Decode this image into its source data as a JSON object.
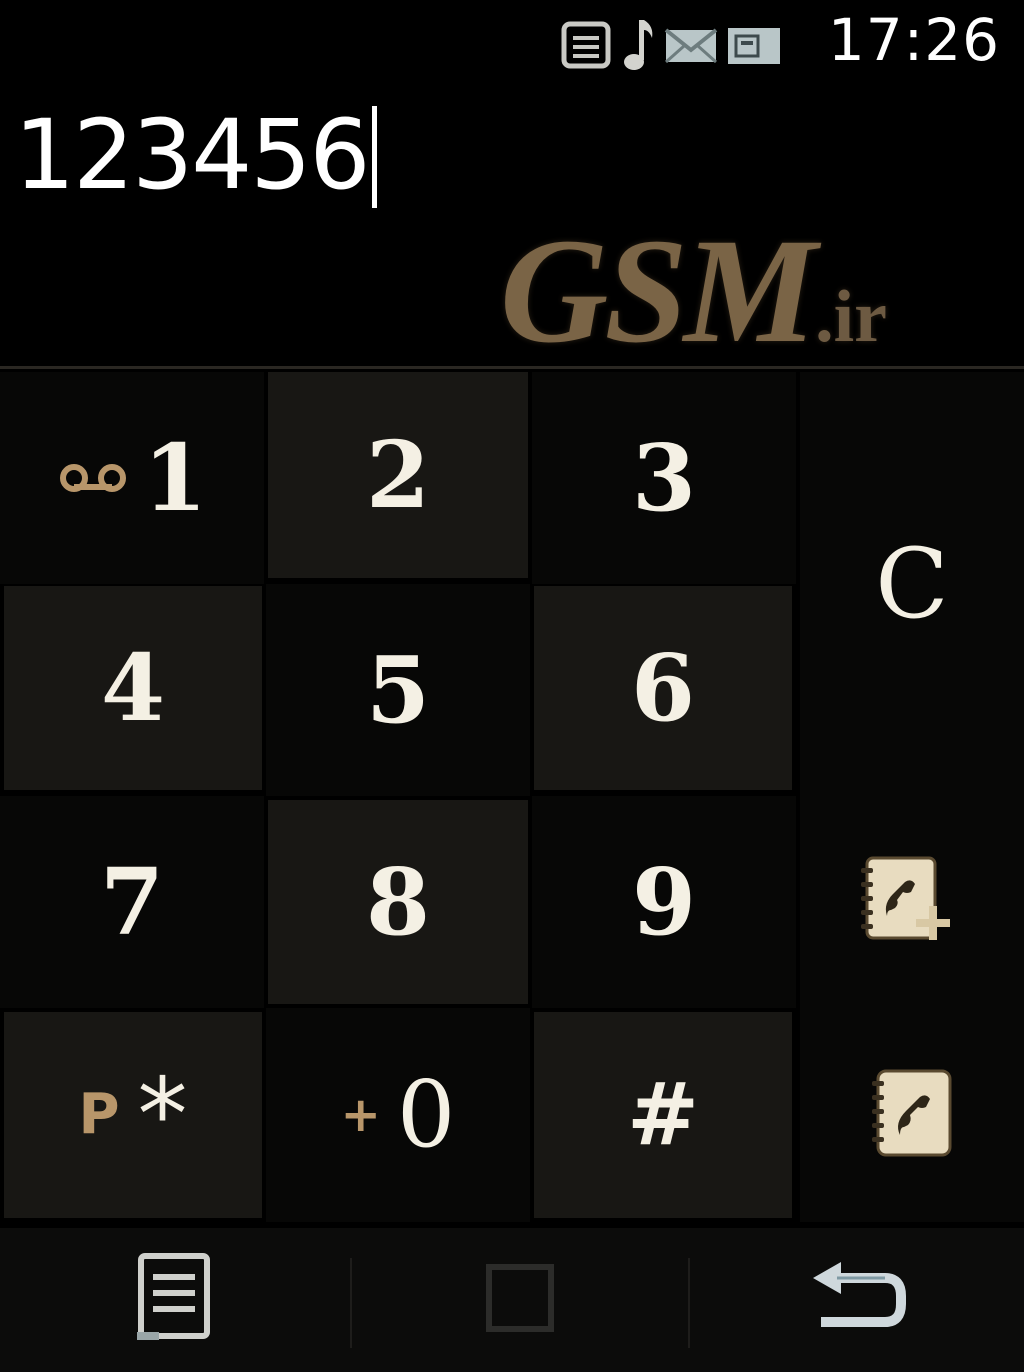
{
  "status_bar": {
    "time": "17:26",
    "icons": [
      "message-list-icon",
      "music-note-icon",
      "envelope-icon",
      "battery-card-icon"
    ]
  },
  "display": {
    "number": "123456",
    "watermark_main": "GSM",
    "watermark_tld": ".ir"
  },
  "keypad": {
    "keys": [
      {
        "digit": "1",
        "sub_icon": "voicemail-icon"
      },
      {
        "digit": "2"
      },
      {
        "digit": "3"
      },
      {
        "digit": "4"
      },
      {
        "digit": "5"
      },
      {
        "digit": "6"
      },
      {
        "digit": "7"
      },
      {
        "digit": "8"
      },
      {
        "digit": "9"
      },
      {
        "digit": "*",
        "sub": "P"
      },
      {
        "digit": "0",
        "sub": "+"
      },
      {
        "digit": "#"
      }
    ],
    "clear_label": "C",
    "add_contact_icon": "phonebook-add-icon",
    "phonebook_icon": "phonebook-icon"
  },
  "bottom_bar": {
    "left_icon": "menu-icon",
    "center_icon": "square-icon",
    "right_icon": "back-arrow-icon"
  },
  "colors": {
    "background": "#000000",
    "key_dark": "#070706",
    "key_light": "#181714",
    "accent_gold": "#b8966a",
    "text": "#f4f0e4"
  }
}
